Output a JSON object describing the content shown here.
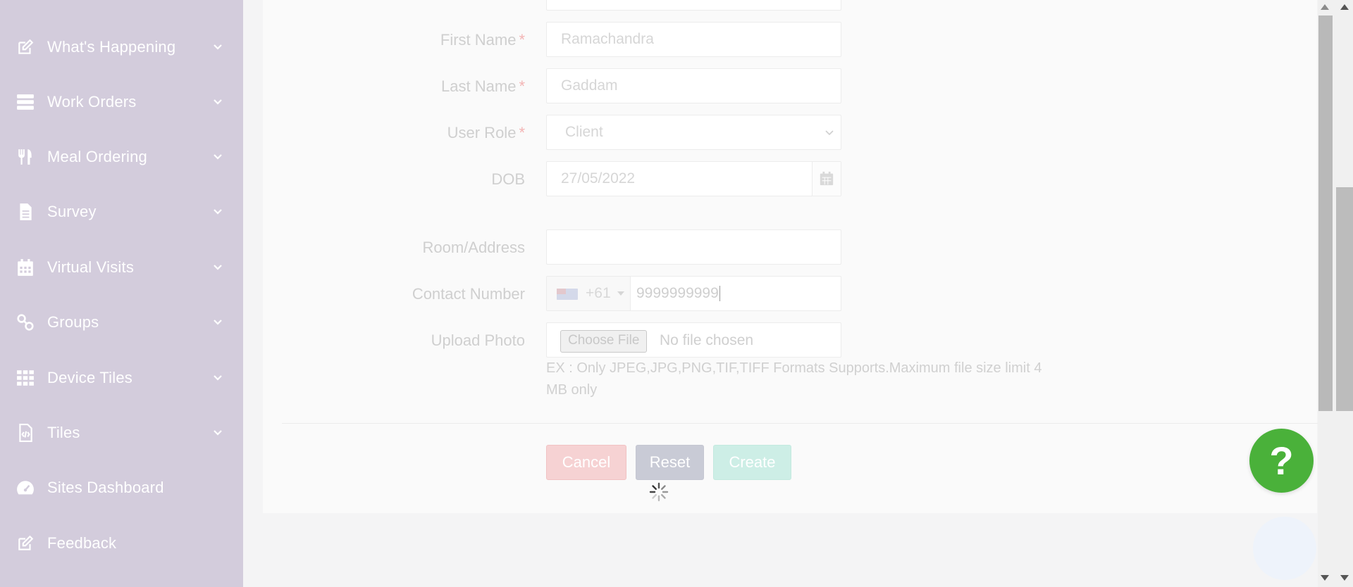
{
  "sidebar": {
    "items": [
      {
        "label": "What's Happening",
        "icon": "edit-icon",
        "has_chevron": true
      },
      {
        "label": "Work Orders",
        "icon": "server-icon",
        "has_chevron": true
      },
      {
        "label": "Meal Ordering",
        "icon": "utensils-icon",
        "has_chevron": true
      },
      {
        "label": "Survey",
        "icon": "document-icon",
        "has_chevron": true
      },
      {
        "label": "Virtual Visits",
        "icon": "calendar-icon",
        "has_chevron": true
      },
      {
        "label": "Groups",
        "icon": "link-icon",
        "has_chevron": true
      },
      {
        "label": "Device Tiles",
        "icon": "grid-icon",
        "has_chevron": true
      },
      {
        "label": "Tiles",
        "icon": "file-code-icon",
        "has_chevron": true
      },
      {
        "label": "Sites Dashboard",
        "icon": "dashboard-icon",
        "has_chevron": false
      },
      {
        "label": "Feedback",
        "icon": "edit-icon",
        "has_chevron": false
      }
    ]
  },
  "form": {
    "first_name": {
      "label": "First Name",
      "required": "*",
      "value": "Ramachandra"
    },
    "last_name": {
      "label": "Last Name",
      "required": "*",
      "value": "Gaddam"
    },
    "user_role": {
      "label": "User Role",
      "required": "*",
      "value": "Client"
    },
    "dob": {
      "label": "DOB",
      "value": "27/05/2022"
    },
    "room_address": {
      "label": "Room/Address",
      "value": ""
    },
    "contact_number": {
      "label": "Contact Number",
      "dial_code": "+61",
      "value": "9999999999"
    },
    "upload_photo": {
      "label": "Upload Photo",
      "button": "Choose File",
      "status": "No file chosen"
    },
    "hint": "EX : Only JPEG,JPG,PNG,TIF,TIFF Formats Supports.Maximum file size limit 4 MB only"
  },
  "actions": {
    "cancel": "Cancel",
    "reset": "Reset",
    "create": "Create"
  },
  "help": {
    "label": "?"
  },
  "colors": {
    "sidebar_bg": "#d3ccdc",
    "help_green": "#4ab13a"
  }
}
